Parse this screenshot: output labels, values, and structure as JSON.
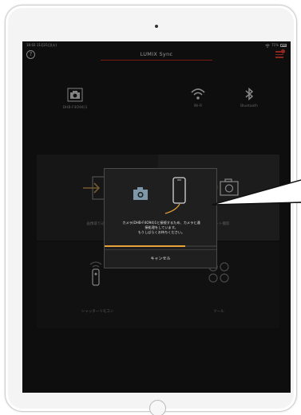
{
  "status_bar": {
    "time": "16:02",
    "date": "11月21日(火)",
    "battery": "71%"
  },
  "navbar": {
    "title": "LUMIX Sync",
    "help_glyph": "?"
  },
  "connection": {
    "camera_label": "DHB-F4O94)1",
    "wifi_label": "Wi-Fi",
    "bluetooth_label": "Bluetooth"
  },
  "tiles": {
    "image_import_label": "画像取り込み",
    "remote_shooting_label": "リモート撮影",
    "shutter_remote_label": "シャッターリモコン",
    "tools_label": "ツール"
  },
  "dialog": {
    "message_line1": "カメラ(DHB-F4O94)1と接続するため、カメラと通",
    "message_line2": "接処理をしています。",
    "message_line3": "もうしばらくお待ちください。",
    "progress": 0.72,
    "cancel_label": "キャンセル"
  },
  "colors": {
    "accent": "#e8a23a",
    "title_underline": "#b5281d",
    "menu_red": "#d63a2f"
  },
  "icons": [
    "help-icon",
    "menu-icon",
    "camera-icon",
    "wifi-icon",
    "bluetooth-icon",
    "import-icon",
    "remote-camera-icon",
    "shutter-remote-icon",
    "tools-icon",
    "phone-icon"
  ]
}
